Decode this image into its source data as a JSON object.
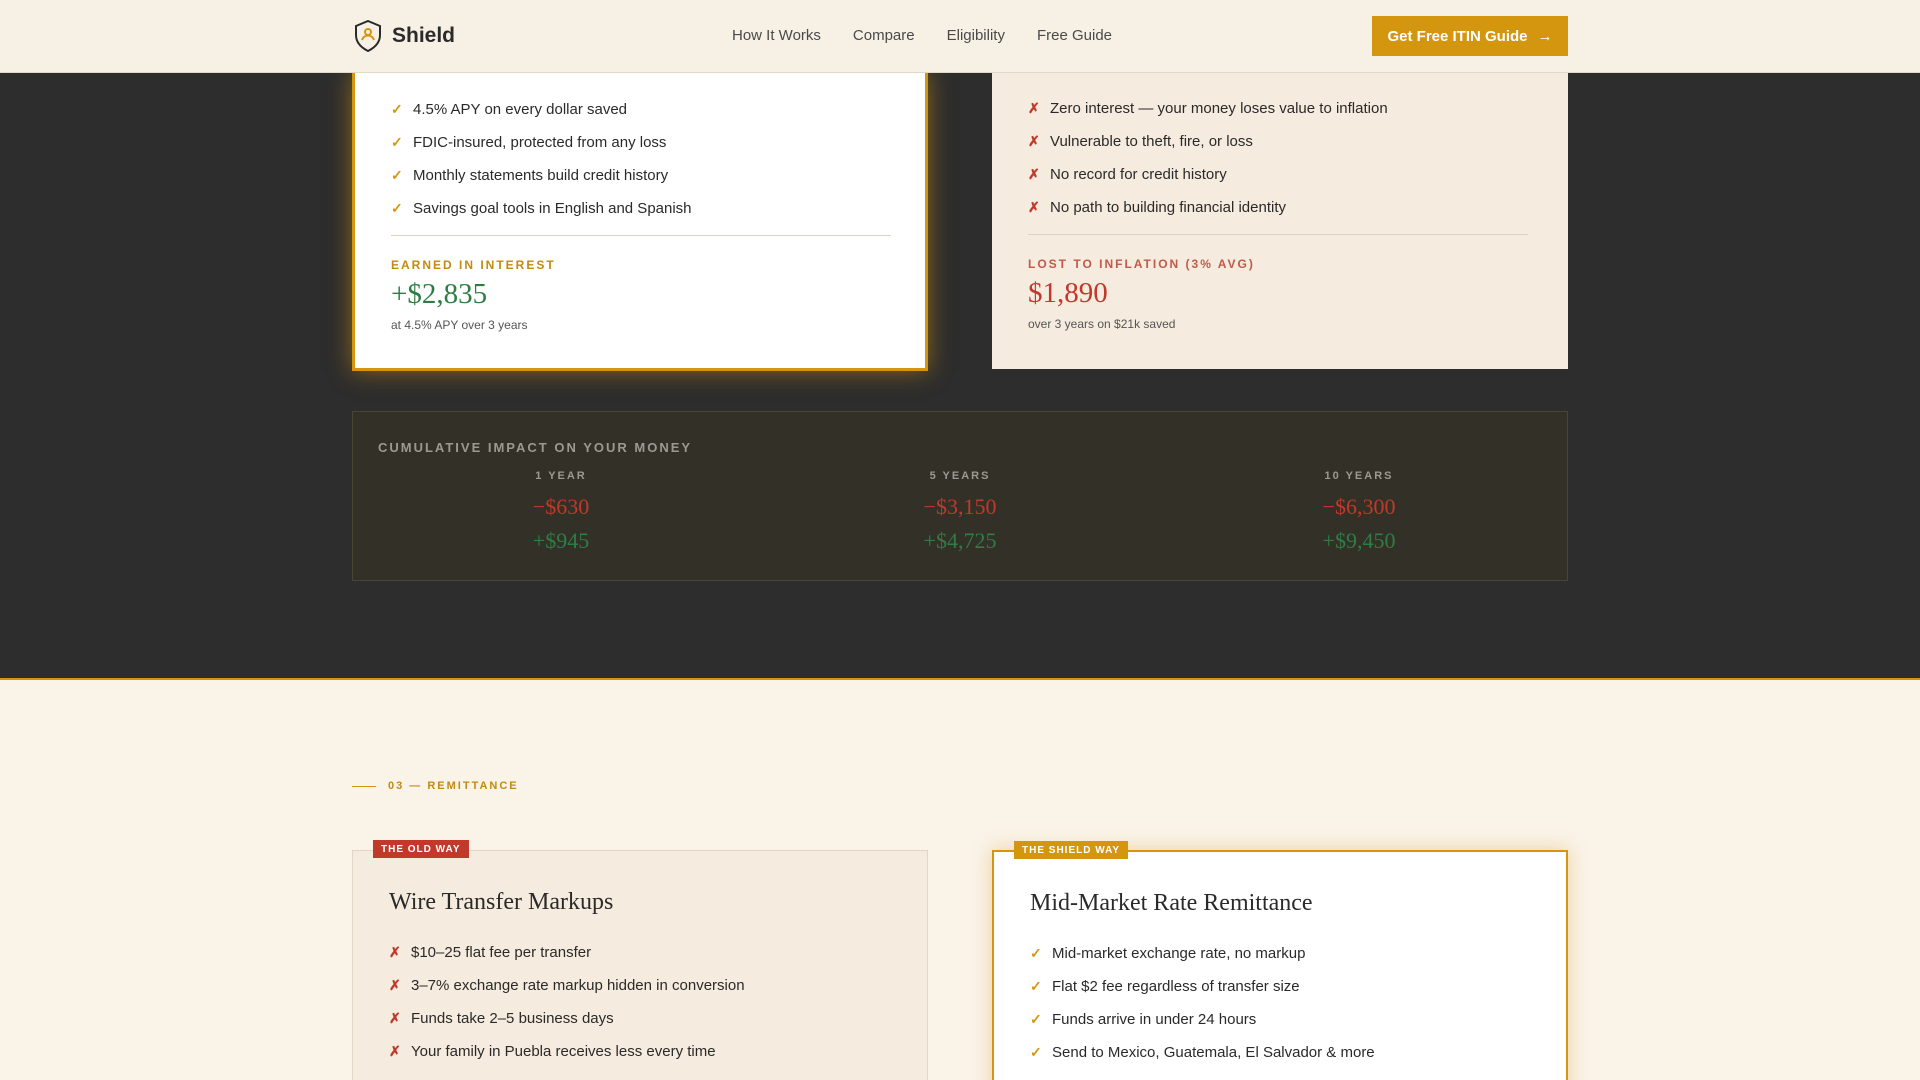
{
  "nav": {
    "brand": "Shield",
    "links": [
      "How It Works",
      "Compare",
      "Eligibility",
      "Free Guide"
    ],
    "cta_label": "Get Free ITIN Guide",
    "cta_arrow": "→"
  },
  "colors": {
    "accent_gold": "#d4960f",
    "dark_bg": "#2d2d2d",
    "light_bg": "#faf3e8",
    "positive_green": "#2e7d45",
    "negative_red": "#c0392b"
  },
  "savings_compare": {
    "shield_card": {
      "features": [
        "4.5% APY on every dollar saved",
        "FDIC-insured, protected from any loss",
        "Monthly statements build credit history",
        "Savings goal tools in English and Spanish"
      ],
      "kicker": "EARNED IN INTEREST",
      "big_value": "+$2,835",
      "sub": "at 4.5% APY over 3 years"
    },
    "old_card": {
      "features": [
        "Zero interest — your money loses value to inflation",
        "Vulnerable to theft, fire, or loss",
        "No record for credit history",
        "No path to building financial identity"
      ],
      "kicker": "LOST TO INFLATION (3% AVG)",
      "big_value": "$1,890",
      "sub": "over 3 years on $21k saved"
    }
  },
  "impact": {
    "title": "CUMULATIVE IMPACT ON YOUR MONEY",
    "columns": [
      {
        "label": "1 YEAR",
        "loss": "−$630",
        "gain": "+$945"
      },
      {
        "label": "5 YEARS",
        "loss": "−$3,150",
        "gain": "+$4,725"
      },
      {
        "label": "10 YEARS",
        "loss": "−$6,300",
        "gain": "+$9,450"
      }
    ]
  },
  "remittance": {
    "section_tag": "03 — REMITTANCE",
    "old": {
      "badge": "THE OLD WAY",
      "title": "Wire Transfer Markups",
      "features": [
        "$10–25 flat fee per transfer",
        "3–7% exchange rate markup hidden in conversion",
        "Funds take 2–5 business days",
        "Your family in Puebla receives less every time"
      ]
    },
    "new": {
      "badge": "THE SHIELD WAY",
      "title": "Mid-Market Rate Remittance",
      "features": [
        "Mid-market exchange rate, no markup",
        "Flat $2 fee regardless of transfer size",
        "Funds arrive in under 24 hours",
        "Send to Mexico, Guatemala, El Salvador & more"
      ]
    }
  },
  "icons": {
    "check": "✓",
    "cross": "✗"
  }
}
